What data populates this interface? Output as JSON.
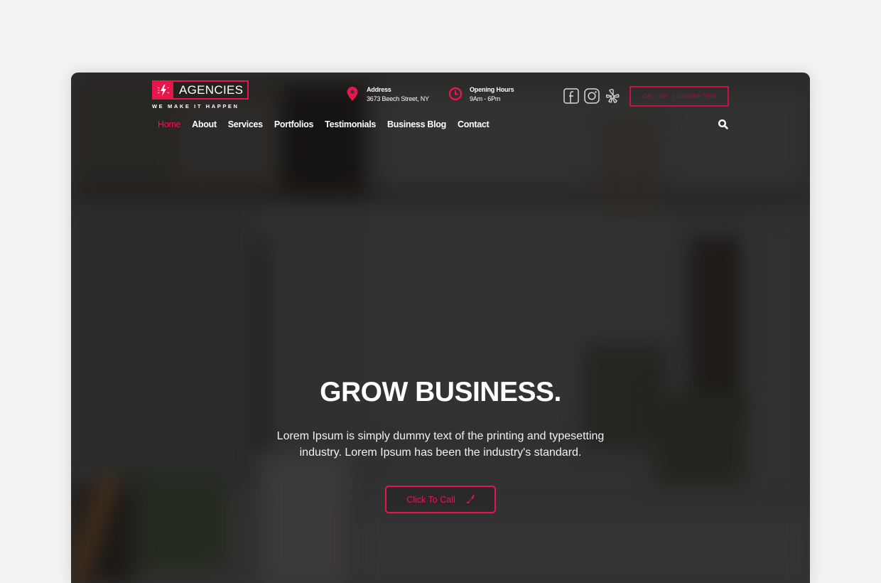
{
  "brand": {
    "name": "AGENCIES",
    "tagline": "WE MAKE IT HAPPEN",
    "accent_color": "#e8174b"
  },
  "header": {
    "address": {
      "title": "Address",
      "value": "3673 Beech Street, NY",
      "icon": "map-pin-icon"
    },
    "hours": {
      "title": "Opening Hours",
      "value": "9Am - 6Pm",
      "icon": "clock-icon"
    },
    "social": [
      {
        "name": "facebook",
        "icon": "facebook-icon"
      },
      {
        "name": "instagram",
        "icon": "instagram-icon"
      },
      {
        "name": "yelp",
        "icon": "yelp-icon"
      }
    ],
    "call_label": "CALL US: 1-123-456-7890"
  },
  "nav": {
    "items": [
      {
        "label": "Home",
        "active": true
      },
      {
        "label": "About",
        "active": false
      },
      {
        "label": "Services",
        "active": false
      },
      {
        "label": "Portfolios",
        "active": false
      },
      {
        "label": "Testimonials",
        "active": false
      },
      {
        "label": "Business Blog",
        "active": false
      },
      {
        "label": "Contact",
        "active": false
      }
    ],
    "search_icon": "search-icon"
  },
  "hero": {
    "title": "GROW BUSINESS.",
    "text": "Lorem Ipsum is simply dummy text of the printing and typesetting industry. Lorem Ipsum has been the industry's standard.",
    "button_label": "Click To Call",
    "button_icon": "phone-icon"
  }
}
